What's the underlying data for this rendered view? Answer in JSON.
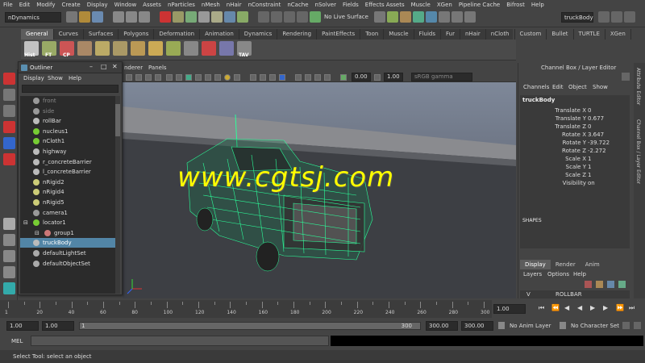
{
  "menus": [
    "File",
    "Edit",
    "Modify",
    "Create",
    "Display",
    "Window",
    "Assets",
    "nParticles",
    "nMesh",
    "nHair",
    "nConstraint",
    "nCache",
    "nSolver",
    "Fields",
    "Effects Assets",
    "Muscle",
    "XGen",
    "Pipeline Cache",
    "Bifrost",
    "Help"
  ],
  "status": {
    "menuset": "nDynamics",
    "live_surface": "No Live Surface",
    "selected_object": "truckBody"
  },
  "shelf": {
    "tabs": [
      "General",
      "Curves",
      "Surfaces",
      "Polygons",
      "Deformation",
      "Animation",
      "Dynamics",
      "Rendering",
      "PaintEffects",
      "Toon",
      "Muscle",
      "Fluids",
      "Fur",
      "nHair",
      "nCloth",
      "Custom",
      "Bullet",
      "TURTLE",
      "XGen"
    ],
    "active_tab": "General",
    "icon_labels": [
      "Hist",
      "FT",
      "CP",
      "TAV"
    ]
  },
  "viewport": {
    "menus": [
      "nderer",
      "Panels"
    ],
    "field_a": "0.00",
    "field_b": "1.00",
    "colorspace": "sRGB gamma"
  },
  "outliner": {
    "title": "Outliner",
    "menus": [
      "Display",
      "Show",
      "Help"
    ],
    "items": [
      {
        "label": "front",
        "icon": "camera-icon",
        "dim": true
      },
      {
        "label": "side",
        "icon": "camera-icon",
        "dim": true
      },
      {
        "label": "rollBar",
        "icon": "mesh-icon"
      },
      {
        "label": "nucleus1",
        "icon": "nucleus-icon"
      },
      {
        "label": "nCloth1",
        "icon": "ncloth-icon"
      },
      {
        "label": "highway",
        "icon": "mesh-icon"
      },
      {
        "label": "r_concreteBarrier",
        "icon": "mesh-icon"
      },
      {
        "label": "l_concreteBarrier",
        "icon": "mesh-icon"
      },
      {
        "label": "nRigid2",
        "icon": "nrigid-icon"
      },
      {
        "label": "nRigid4",
        "icon": "nrigid-icon"
      },
      {
        "label": "nRigid5",
        "icon": "nrigid-icon"
      },
      {
        "label": "camera1",
        "icon": "camera-icon"
      },
      {
        "label": "locator1",
        "icon": "locator-icon"
      },
      {
        "label": "group1",
        "icon": "group-icon"
      },
      {
        "label": "truckBody",
        "icon": "mesh-icon",
        "selected": true
      },
      {
        "label": "defaultLightSet",
        "icon": "set-icon"
      },
      {
        "label": "defaultObjectSet",
        "icon": "set-icon"
      }
    ]
  },
  "channel_box": {
    "header": "Channel Box / Layer Editor",
    "menus": [
      "Channels",
      "Edit",
      "Object",
      "Show"
    ],
    "object": "truckBody",
    "attributes": [
      {
        "name": "Translate X",
        "value": "0"
      },
      {
        "name": "Translate Y",
        "value": "0.677"
      },
      {
        "name": "Translate Z",
        "value": "0"
      },
      {
        "name": "Rotate X",
        "value": "3.647"
      },
      {
        "name": "Rotate Y",
        "value": "-39.722"
      },
      {
        "name": "Rotate Z",
        "value": "-2.272"
      },
      {
        "name": "Scale X",
        "value": "1"
      },
      {
        "name": "Scale Y",
        "value": "1"
      },
      {
        "name": "Scale Z",
        "value": "1"
      },
      {
        "name": "Visibility",
        "value": "on"
      }
    ],
    "shapes_label": "SHAPES",
    "tabs": [
      "Display",
      "Render",
      "Anim"
    ],
    "active_tab": "Display",
    "layer_menus": [
      "Layers",
      "Options",
      "Help"
    ],
    "layer_visibility": "V",
    "layer_name": "ROLLBAR"
  },
  "side_tabs": [
    "Attribute Editor",
    "Channel Box / Layer Editor"
  ],
  "timeline": {
    "ticks": [
      "1",
      "",
      "20",
      "",
      "40",
      "",
      "60",
      "",
      "80",
      "",
      "100",
      "",
      "120",
      "",
      "140",
      "",
      "160",
      "",
      "180",
      "",
      "200",
      "",
      "220",
      "",
      "240",
      "",
      "260",
      "",
      "280",
      "",
      "300"
    ],
    "current_frame": "1.00"
  },
  "range": {
    "start": "1.00",
    "inner_start": "1.00",
    "range_start_thumb": "1",
    "range_end_thumb": "300",
    "end": "300.00",
    "inner_end": "300.00",
    "anim_layer": "No Anim Layer",
    "character_set": "No Character Set"
  },
  "command": {
    "label": "MEL"
  },
  "help_line": "Select Tool: select an object",
  "watermark": "www.cgtsj.com",
  "colors": {
    "wire": "#2cff9a",
    "selected": "#5285a6",
    "watermark": "#ffff00"
  }
}
